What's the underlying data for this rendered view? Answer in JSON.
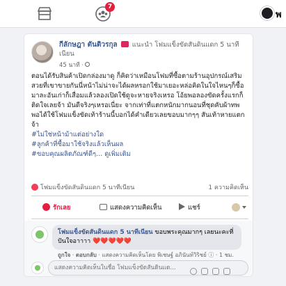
{
  "topbar": {
    "badge_count": "7",
    "profile_letter": "พ"
  },
  "post": {
    "author_name": "กีลักษฎา ตันติวรกุล",
    "recommend_text": "แนะนำ โฟมแข็งขัดสันดินแดก 5 นาทีเนียน",
    "time": "45 นาที ·",
    "body": "ตอนได้รับสินค้าเปิดกล่องมาดู ก็คิดว่าเหมือนโฟมที่ซื้อตามร้านอุปกรณ์เสริมสวยที่เขาขายกันนี่หน้าไม่น่าจะได้ผลหรอกใช้มาเยอะหล่อคิดในใจไหนๆก็ซื้อมาละอันเก่าก็เสื่อมแล้วลองเปิดใช้ดูจะหายจริงเหรอ โอ้ยพอลองขัดครั้งแรกก็ติดใจเลยจ้า มันดีจริงๆเหรอเนี่ยะ จากเท่าที่แตกหนักมากนอนที่ชุดคับผ้าทพ พอได้ใช้โฟมแข็งขัดเท้าร้านนี้บอกได้คำเดียวเลยขอบมากๆๆ สันเท้าหายแตกจ้า",
    "hashtags": [
      "#ไม่ใช่หน้าม้าแต่อย่างใด",
      "#ลูกค้าที่ซื้อมาใช้จริงแล้วเห็นผล",
      "#ขอบคุณผลิตภัณฑ์ดีๆ..."
    ],
    "see_more": "ดูเพิ่มเติม",
    "link_text": "โฟมแข็งขัดสันดินแดก 5 นาทีเนียน",
    "comment_count": "1 ความคิดเห็น"
  },
  "actions": {
    "like": "รักเลย",
    "comment": "แสดงความคิดเห็น",
    "share": "แชร์"
  },
  "comment": {
    "name": "โฟมแข็งขัดสันดินแดก 5 นาทีเนียน",
    "text": "ขอบพระคุณมากๆ เลยนะคะที่ ปันใจอาาาา",
    "hearts": "❤️❤️❤️❤️❤️",
    "like_link": "ถูกใจ",
    "reply_link": "ตอบกลับ",
    "meta_rest": "· แสดงความคิดเห็นโดย พิเชษฐ์ อภินันท์วิริชย์ ⓘ · 1 ชม."
  },
  "composer": {
    "placeholder": "แสดงความคิดเห็นในชื่อ โฟมแข็งขัดสันดินแด..."
  },
  "colors": {
    "link_blue": "#385898",
    "love_red": "#e41e3f",
    "muted": "#65676b"
  }
}
